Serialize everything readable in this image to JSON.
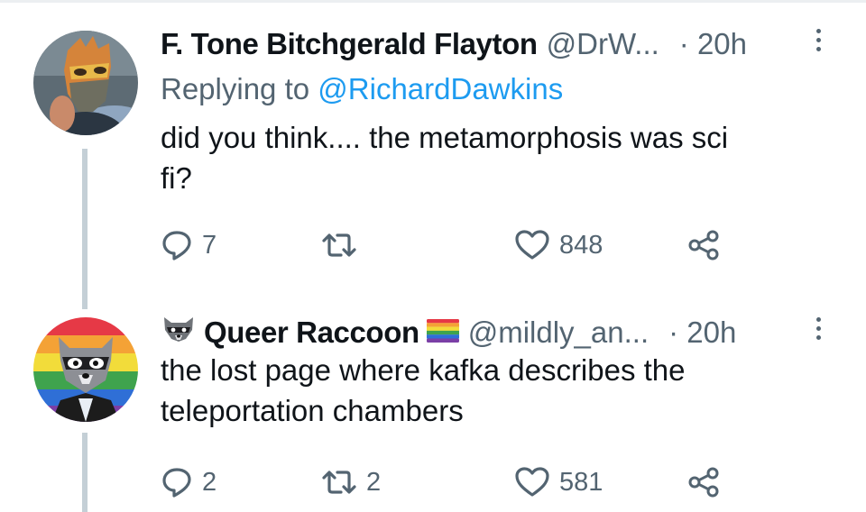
{
  "tweets": [
    {
      "author_name": "F. Tone Bitchgerald Flayton",
      "handle": "@DrW...",
      "time": "· 20h",
      "replying_prefix": "Replying to",
      "replying_to": "@RichardDawkins",
      "text_line1": "did you think.... the metamorphosis was sci",
      "text_line2": "fi?",
      "replies": "7",
      "retweets": "",
      "likes": "848",
      "avatar_icon": "masked-person-avatar"
    },
    {
      "author_name": "Queer Raccoon",
      "handle": "@mildly_an...",
      "time": "· 20h",
      "text_line1": "the lost page where kafka describes the",
      "text_line2": "teleportation chambers",
      "replies": "2",
      "retweets": "2",
      "likes": "581",
      "avatar_icon": "raccoon-rainbow-avatar",
      "name_emoji_left": "raccoon-emoji",
      "name_emoji_right": "rainbow-flag-emoji"
    }
  ],
  "colors": {
    "text": "#0f1419",
    "secondary": "#536471",
    "link": "#1d9bf0",
    "thread_line": "#c4cfd6"
  }
}
